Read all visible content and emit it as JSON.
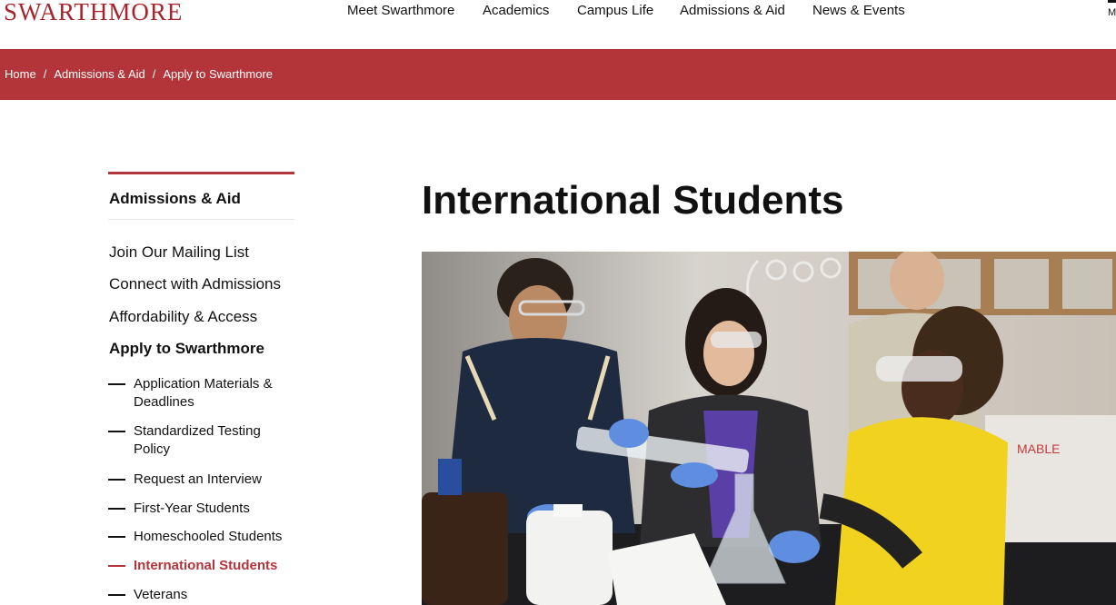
{
  "site": {
    "logo": "SWARTHMORE"
  },
  "nav": {
    "items": [
      "Meet Swarthmore",
      "Academics",
      "Campus Life",
      "Admissions & Aid",
      "News & Events"
    ],
    "menu_glyph": "M"
  },
  "breadcrumb": {
    "items": [
      "Home",
      "Admissions & Aid",
      "Apply to Swarthmore"
    ],
    "separator": "/"
  },
  "sidebar": {
    "heading": "Admissions & Aid",
    "items": [
      {
        "label": "Join Our Mailing List"
      },
      {
        "label": "Connect with Admissions"
      },
      {
        "label": "Affordability & Access"
      },
      {
        "label": "Apply to Swarthmore",
        "current": true
      }
    ],
    "subitems": [
      {
        "label": "Application Materials & Deadlines"
      },
      {
        "label": "Standardized Testing Policy"
      },
      {
        "label": "Request an Interview"
      },
      {
        "label": "First-Year Students"
      },
      {
        "label": "Homeschooled Students"
      },
      {
        "label": "International Students",
        "active": true
      },
      {
        "label": "Veterans"
      }
    ]
  },
  "main": {
    "title": "International Students"
  },
  "colors": {
    "brand_red": "#b3353a",
    "logo_red": "#a8242c",
    "text": "#111111"
  }
}
